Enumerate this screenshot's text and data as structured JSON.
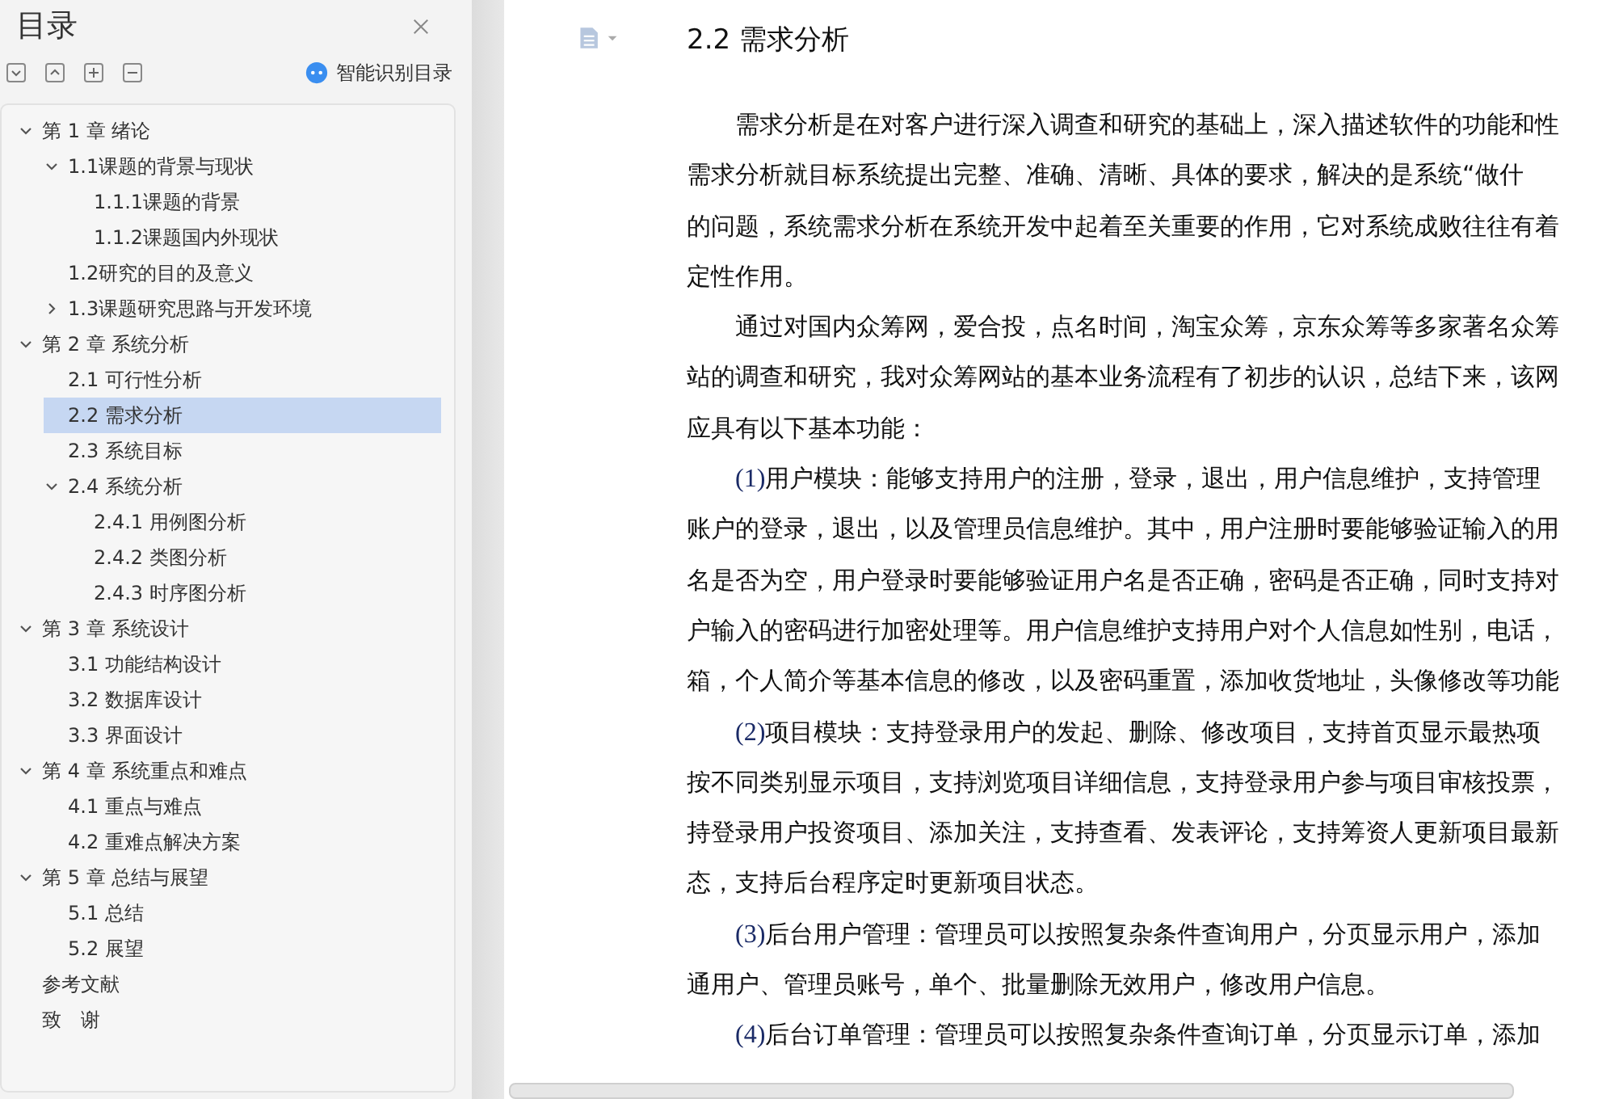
{
  "sidebar": {
    "title": "目录",
    "smart_button": "智能识别目录",
    "toc": [
      {
        "label": "第 1 章  绪论",
        "expanded": true,
        "selected": false,
        "children": [
          {
            "label": "1.1课题的背景与现状",
            "expanded": true,
            "selected": false,
            "children": [
              {
                "label": "1.1.1课题的背景",
                "selected": false
              },
              {
                "label": "1.1.2课题国内外现状",
                "selected": false
              }
            ]
          },
          {
            "label": "1.2研究的目的及意义",
            "selected": false
          },
          {
            "label": "1.3课题研究思路与开发环境",
            "expanded": false,
            "selected": false
          }
        ]
      },
      {
        "label": "第 2 章  系统分析",
        "expanded": true,
        "selected": false,
        "children": [
          {
            "label": "2.1 可行性分析",
            "selected": false
          },
          {
            "label": "2.2 需求分析",
            "selected": true
          },
          {
            "label": "2.3 系统目标",
            "selected": false
          },
          {
            "label": "2.4 系统分析",
            "expanded": true,
            "selected": false,
            "children": [
              {
                "label": "2.4.1 用例图分析",
                "selected": false
              },
              {
                "label": "2.4.2 类图分析",
                "selected": false
              },
              {
                "label": "2.4.3 时序图分析",
                "selected": false
              }
            ]
          }
        ]
      },
      {
        "label": "第 3 章  系统设计",
        "expanded": true,
        "selected": false,
        "children": [
          {
            "label": "3.1 功能结构设计",
            "selected": false
          },
          {
            "label": "3.2 数据库设计",
            "selected": false
          },
          {
            "label": "3.3 界面设计",
            "selected": false
          }
        ]
      },
      {
        "label": "第 4 章  系统重点和难点",
        "expanded": true,
        "selected": false,
        "children": [
          {
            "label": "4.1 重点与难点",
            "selected": false
          },
          {
            "label": "4.2 重难点解决方案",
            "selected": false
          }
        ]
      },
      {
        "label": "第 5 章  总结与展望",
        "expanded": true,
        "selected": false,
        "children": [
          {
            "label": "5.1 总结",
            "selected": false
          },
          {
            "label": "5.2 展望",
            "selected": false
          }
        ]
      },
      {
        "label": "参考文献",
        "selected": false
      },
      {
        "label": "致　谢",
        "selected": false
      }
    ]
  },
  "document": {
    "heading": "2.2 需求分析",
    "paragraphs": [
      {
        "lines": [
          "需求分析是在对客户进行深入调查和研究的基础上，深入描述软件的功能和性",
          "需求分析就目标系统提出完整、准确、清晰、具体的要求，解决的是系统“做什",
          "的问题，系统需求分析在系统开发中起着至关重要的作用，它对系统成败往往有着",
          "定性作用。"
        ]
      },
      {
        "lines": [
          "通过对国内众筹网，爱合投，点名时间，淘宝众筹，京东众筹等多家著名众筹",
          "站的调查和研究，我对众筹网站的基本业务流程有了初步的认识，总结下来，该网",
          "应具有以下基本功能："
        ]
      },
      {
        "number": "(1)",
        "lines": [
          "用户模块：能够支持用户的注册，登录，退出，用户信息维护，支持管理",
          "账户的登录，退出，以及管理员信息维护。其中，用户注册时要能够验证输入的用",
          "名是否为空，用户登录时要能够验证用户名是否正确，密码是否正确，同时支持对",
          "户输入的密码进行加密处理等。用户信息维护支持用户对个人信息如性别，电话，",
          "箱，个人简介等基本信息的修改，以及密码重置，添加收货地址，头像修改等功能"
        ]
      },
      {
        "number": "(2)",
        "lines": [
          "项目模块：支持登录用户的发起、删除、修改项目，支持首页显示最热项",
          "按不同类别显示项目，支持浏览项目详细信息，支持登录用户参与项目审核投票，",
          "持登录用户投资项目、添加关注，支持查看、发表评论，支持筹资人更新项目最新",
          "态，支持后台程序定时更新项目状态。"
        ]
      },
      {
        "number": "(3)",
        "lines": [
          "后台用户管理：管理员可以按照复杂条件查询用户，分页显示用户，添加",
          "通用户、管理员账号，单个、批量删除无效用户，修改用户信息。"
        ]
      },
      {
        "number": "(4)",
        "lines": [
          "后台订单管理：管理员可以按照复杂条件查询订单，分页显示订单，添加"
        ]
      }
    ]
  }
}
